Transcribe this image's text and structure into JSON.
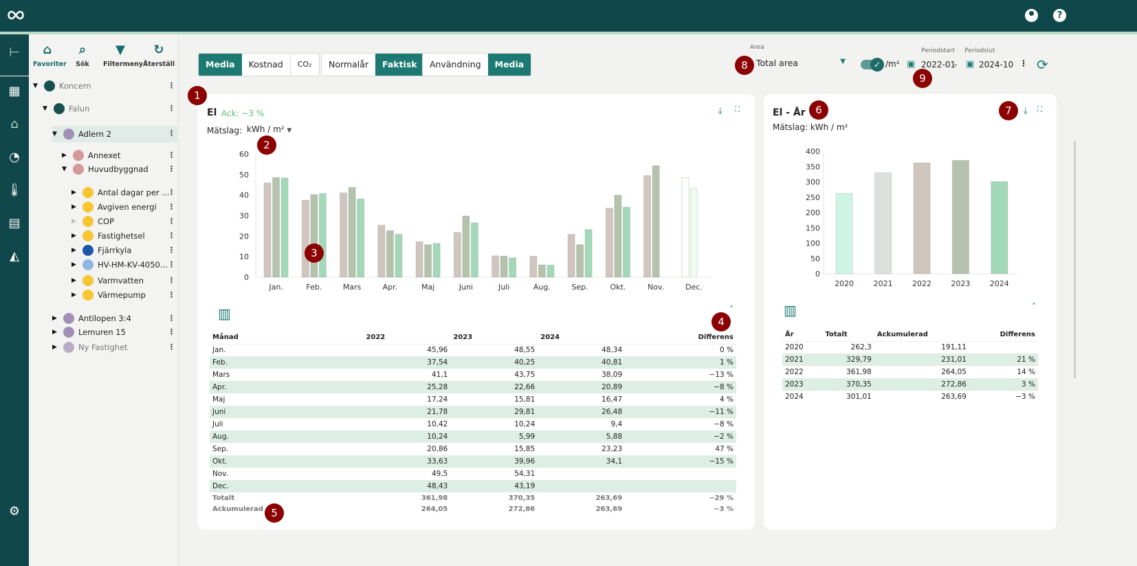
{
  "header": {
    "logo": "infinity-logo",
    "icons": [
      "account-icon",
      "help-icon"
    ]
  },
  "rail": {
    "icons": [
      "tree-icon",
      "dashboard-icon",
      "building-icon",
      "gauge-icon",
      "thermometer-icon",
      "report-icon",
      "settings-building-icon",
      "settings-icon"
    ]
  },
  "tree_toolbar": [
    {
      "label": "Favoriter",
      "icon": "home-star-icon"
    },
    {
      "label": "Sök",
      "icon": "search-icon"
    },
    {
      "label": "Filtermeny",
      "icon": "filter-icon"
    },
    {
      "label": "Återställ",
      "icon": "refresh-icon"
    }
  ],
  "tree": [
    {
      "label": "Koncern",
      "level": 0,
      "expanded": true,
      "color": "#16514f",
      "dim": true
    },
    {
      "label": "Falun",
      "level": 1,
      "expanded": true,
      "color": "#16514f",
      "dim": true
    },
    {
      "label": "Adlern 2",
      "level": 2,
      "expanded": true,
      "color": "#a38fb6",
      "selected": true
    },
    {
      "label": "Annexet",
      "level": 3,
      "expanded": false,
      "color": "#d49a9a"
    },
    {
      "label": "Huvudbyggnad",
      "level": 3,
      "expanded": true,
      "color": "#d49a9a"
    },
    {
      "label": "Antal dagar per ...",
      "level": 4,
      "color": "#f7c531"
    },
    {
      "label": "Avgiven energi",
      "level": 4,
      "color": "#f7c531"
    },
    {
      "label": "COP",
      "level": 4,
      "color": "#f7c531",
      "noarrow": true
    },
    {
      "label": "Fastighetsel",
      "level": 4,
      "color": "#f7c531"
    },
    {
      "label": "Fjärrkyla",
      "level": 4,
      "color": "#1e56a8"
    },
    {
      "label": "HV-HM-KV-4050...",
      "level": 4,
      "color": "#8fb7e4"
    },
    {
      "label": "Varmvatten",
      "level": 4,
      "color": "#f7c531"
    },
    {
      "label": "Värmepump",
      "level": 4,
      "color": "#f7c531"
    },
    {
      "label": "Antilopen 3:4",
      "level": 2,
      "color": "#a38fb6"
    },
    {
      "label": "Lemuren 15",
      "level": 2,
      "color": "#a38fb6"
    },
    {
      "label": "Ny Fastighet",
      "level": 2,
      "color": "#b9aac6",
      "dim": true
    }
  ],
  "toolbar": {
    "group1": [
      "Media",
      "Kostnad",
      "CO₂"
    ],
    "group1_active": 0,
    "group2": [
      "Normalår",
      "Faktisk"
    ],
    "group2_active": 1,
    "group3": [
      "Användning",
      "Media"
    ],
    "group3_active": 1,
    "area_label": "Area",
    "area_value": "Total area",
    "per_m2": "/m²",
    "per_m2_on": true,
    "period_start_label": "Periodstart",
    "period_start": "2022-01",
    "dash": "-",
    "period_end_label": "Periodslut",
    "period_end": "2024-10"
  },
  "left_card": {
    "title": "El",
    "ack": "Ack: −3 %",
    "measure_label": "Mätslag:",
    "measure_value": "kWh / m²",
    "table": {
      "headers": [
        "Månad",
        "2022",
        "2023",
        "2024",
        "Differens"
      ],
      "rows": [
        [
          "Jan.",
          "45,96",
          "48,55",
          "48,34",
          "0 %"
        ],
        [
          "Feb.",
          "37,54",
          "40,25",
          "40,81",
          "1 %"
        ],
        [
          "Mars",
          "41,1",
          "43,75",
          "38,09",
          "−13 %"
        ],
        [
          "Apr.",
          "25,28",
          "22,66",
          "20,89",
          "−8 %"
        ],
        [
          "Maj",
          "17,24",
          "15,81",
          "16,47",
          "4 %"
        ],
        [
          "Juni",
          "21,78",
          "29,81",
          "26,48",
          "−11 %"
        ],
        [
          "Juli",
          "10,42",
          "10,24",
          "9,4",
          "−8 %"
        ],
        [
          "Aug.",
          "10,24",
          "5,99",
          "5,88",
          "−2 %"
        ],
        [
          "Sep.",
          "20,86",
          "15,85",
          "23,23",
          "47 %"
        ],
        [
          "Okt.",
          "33,63",
          "39,96",
          "34,1",
          "−15 %"
        ],
        [
          "Nov.",
          "49,5",
          "54,31",
          "",
          ""
        ],
        [
          "Dec.",
          "48,43",
          "43,19",
          "",
          ""
        ]
      ],
      "footer": [
        [
          "Totalt",
          "361,98",
          "370,35",
          "263,69",
          "−29 %"
        ],
        [
          "Ackumulerad",
          "264,05",
          "272,86",
          "263,69",
          "−3 %"
        ]
      ]
    }
  },
  "right_card": {
    "title": "El - År",
    "measure": "Mätslag: kWh / m²",
    "table": {
      "headers": [
        "År",
        "Totalt",
        "Ackumulerad",
        "Differens"
      ],
      "rows": [
        [
          "2020",
          "262,3",
          "191,11",
          ""
        ],
        [
          "2021",
          "329,79",
          "231,01",
          "21 %"
        ],
        [
          "2022",
          "361,98",
          "264,05",
          "14 %"
        ],
        [
          "2023",
          "370,35",
          "272,86",
          "3 %"
        ],
        [
          "2024",
          "301,01",
          "263,69",
          "−3 %"
        ]
      ]
    }
  },
  "chart_data": [
    {
      "type": "bar",
      "categories": [
        "Jan.",
        "Feb.",
        "Mars",
        "Apr.",
        "Maj",
        "Juni",
        "Juli",
        "Aug.",
        "Sep.",
        "Okt.",
        "Nov.",
        "Dec."
      ],
      "series": [
        {
          "name": "2022",
          "color": "#d0c5bf",
          "values": [
            45.96,
            37.54,
            41.1,
            25.28,
            17.24,
            21.78,
            10.42,
            10.24,
            20.86,
            33.63,
            49.5,
            48.43
          ]
        },
        {
          "name": "2023",
          "color": "#b5c3ad",
          "values": [
            48.55,
            40.25,
            43.75,
            22.66,
            15.81,
            29.81,
            10.24,
            5.99,
            15.85,
            39.96,
            54.31,
            43.19
          ]
        },
        {
          "name": "2024",
          "color": "#a3d9b8",
          "values": [
            48.34,
            40.81,
            38.09,
            20.89,
            16.47,
            26.48,
            9.4,
            5.88,
            23.23,
            34.1,
            null,
            null
          ]
        }
      ],
      "yticks": [
        0,
        10,
        20,
        30,
        40,
        50,
        60
      ],
      "ylim": [
        0,
        60
      ],
      "outlined_category": "Dec."
    },
    {
      "type": "bar",
      "categories": [
        "2020",
        "2021",
        "2022",
        "2023",
        "2024"
      ],
      "values": [
        262.3,
        329.79,
        361.98,
        370.35,
        301.01
      ],
      "colors": [
        "#cdf5e6",
        "#dde1de",
        "#d0c5bf",
        "#b5c3ad",
        "#a3d9b8"
      ],
      "yticks": [
        0,
        50,
        100,
        150,
        200,
        250,
        300,
        350,
        400
      ],
      "ylim": [
        0,
        400
      ]
    }
  ],
  "markers": [
    "1",
    "2",
    "3",
    "4",
    "5",
    "6",
    "7",
    "8",
    "9"
  ]
}
